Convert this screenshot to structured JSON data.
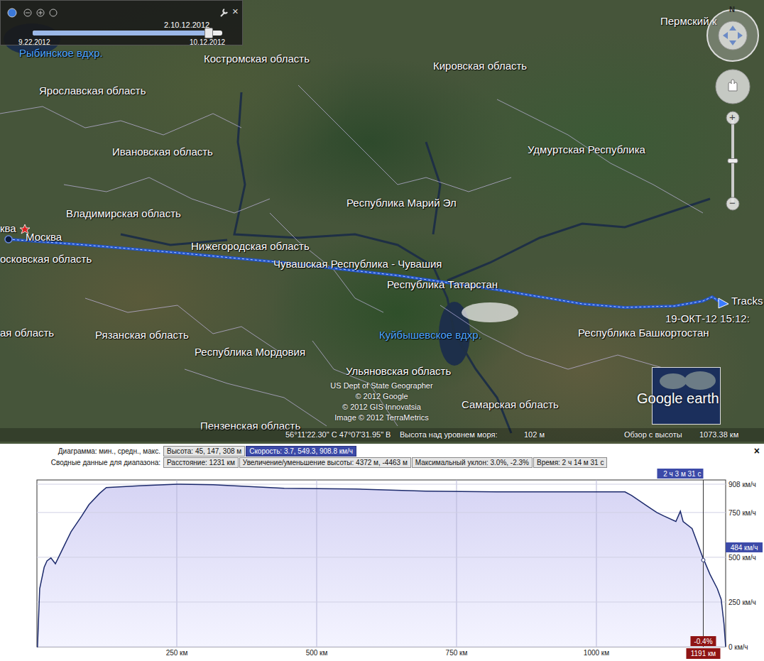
{
  "time_slider": {
    "current": "2.10.12.2012",
    "start": "9.22.2012",
    "end": "10.12.2012",
    "level": 0.93,
    "close": "×"
  },
  "map_labels": [
    {
      "text": "Рыбинское вдхр.",
      "kind": "water"
    },
    {
      "text": "Костромская область",
      "kind": "region"
    },
    {
      "text": "Кировская область",
      "kind": "region"
    },
    {
      "text": "Пермский к",
      "kind": "region"
    },
    {
      "text": "Ярославская область",
      "kind": "region"
    },
    {
      "text": "Ивановская область",
      "kind": "region"
    },
    {
      "text": "Удмуртская Республика",
      "kind": "region"
    },
    {
      "text": "Владимирская область",
      "kind": "region"
    },
    {
      "text": "Республика Марий Эл",
      "kind": "region"
    },
    {
      "text": "ква",
      "kind": "region"
    },
    {
      "text": "Москва",
      "kind": "city"
    },
    {
      "text": "осковская область",
      "kind": "region"
    },
    {
      "text": "Нижегородская область",
      "kind": "region"
    },
    {
      "text": "Чувашская Республика - Чувашия",
      "kind": "region"
    },
    {
      "text": "Республика Татарстан",
      "kind": "region"
    },
    {
      "text": "Республика Башкортостан",
      "kind": "region"
    },
    {
      "text": "ая область",
      "kind": "region"
    },
    {
      "text": "Рязанская область",
      "kind": "region"
    },
    {
      "text": "Республика Мордовия",
      "kind": "region"
    },
    {
      "text": "Куйбышевское вдхр.",
      "kind": "water"
    },
    {
      "text": "Ульяновская область",
      "kind": "region"
    },
    {
      "text": "Самарская область",
      "kind": "region"
    },
    {
      "text": "Пензенская область",
      "kind": "region"
    }
  ],
  "track": {
    "label": "Tracks",
    "timestamp": "19-ОКТ-12 15:12:"
  },
  "attribution": [
    "US Dept of State Geographer",
    "© 2012 Google",
    "© 2012 GIS Innovatsia",
    "Image © 2012 TerraMetrics"
  ],
  "logo": "Google earth",
  "nav": {
    "north": "N",
    "zoom_in": "+",
    "zoom_out": "−",
    "zoom_level": 0.5
  },
  "status_bar": {
    "coords": "56°11'22.30\" С  47°07'31.95\" В",
    "altitude_label": "Высота над уровнем моря:",
    "altitude": "102 м",
    "eye_label": "Обзор с высоты",
    "eye": "1073.38 км"
  },
  "panel": {
    "diagram_label": "Диаграмма: мин., средн., макс.",
    "diagram_options": [
      {
        "text": "Высота: 45, 147, 308 м",
        "selected": false
      },
      {
        "text": "Скорость: 3.7, 549.3, 908.8 км/ч",
        "selected": true
      }
    ],
    "summary_label": "Сводные данные для диапазона:",
    "summary": [
      "Расстояние: 1231 км",
      "Увеличение/уменьшение высоты: 4372 м, -4463 м",
      "Максимальный уклон: 3.0%, -2.3%",
      "Время: 2 ч 14 м 31 с"
    ],
    "close": "×"
  },
  "profile": {
    "x_ticks": [
      "250 км",
      "500 км",
      "750 км",
      "1000 км"
    ],
    "y_ticks": [
      "908 км/ч",
      "750 км/ч",
      "500 км/ч",
      "250 км/ч",
      "0 км/ч"
    ],
    "distance_km": [
      0,
      1,
      5,
      13,
      18,
      25,
      33,
      48,
      61,
      80,
      93,
      112,
      124,
      188,
      251,
      315,
      442,
      569,
      695,
      822,
      949,
      1051,
      1063,
      1089,
      1108,
      1121,
      1142,
      1150,
      1155,
      1171,
      1190,
      1203,
      1216,
      1223,
      1228,
      1231
    ],
    "speed_kmh": [
      0,
      0,
      325,
      444,
      480,
      496,
      464,
      560,
      643,
      730,
      794,
      857,
      889,
      900,
      908,
      905,
      885,
      881,
      869,
      865,
      865,
      865,
      845,
      790,
      750,
      730,
      700,
      757,
      700,
      660,
      500,
      405,
      325,
      265,
      130,
      0
    ],
    "cursor": {
      "distance_km": 1191,
      "speed": "484 км/ч",
      "distance": "1191 км",
      "slope": "-0.4%",
      "time": "2 ч 3 м 31 с"
    }
  }
}
